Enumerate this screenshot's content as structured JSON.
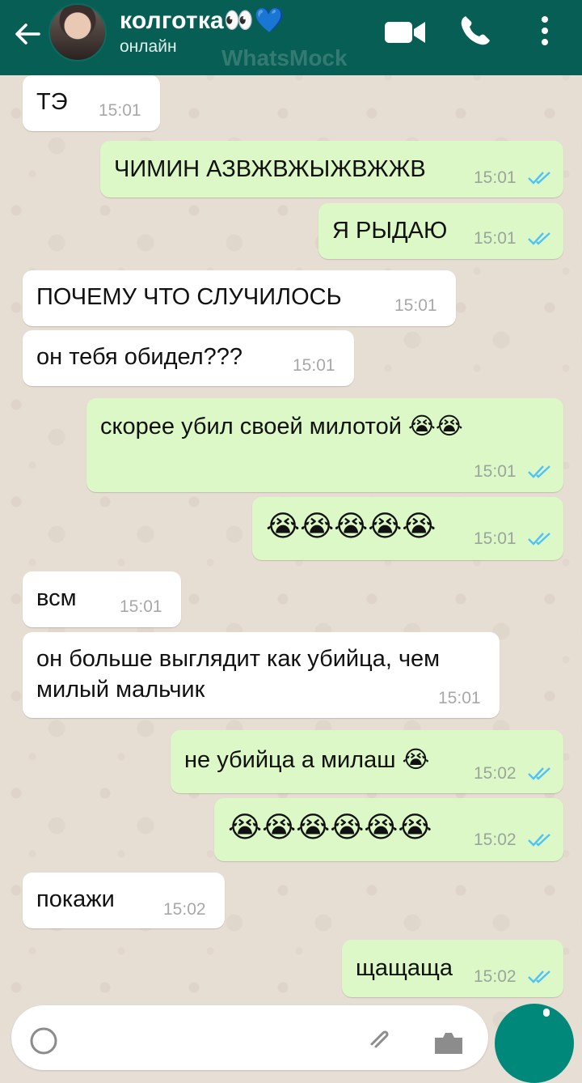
{
  "header": {
    "contact_name": "колготка👀💙",
    "status": "онлайн",
    "watermark": "WhatsMock"
  },
  "colors": {
    "header": "#075e54",
    "incoming_bubble": "#ffffff",
    "outgoing_bubble": "#dcf8c6",
    "read_ticks": "#4fc3f7",
    "mic_button": "#00897b"
  },
  "messages": [
    {
      "direction": "in",
      "text": "ТЭ",
      "time": "15:01"
    },
    {
      "direction": "out",
      "text": "ЧИМИН АЗВЖВЖЫЖВЖЖВ",
      "time": "15:01",
      "read": true
    },
    {
      "direction": "out",
      "text": "Я РЫДАЮ",
      "time": "15:01",
      "read": true
    },
    {
      "direction": "in",
      "text": "ПОЧЕМУ ЧТО СЛУЧИЛОСЬ",
      "time": "15:01"
    },
    {
      "direction": "in",
      "text": "он тебя обидел???",
      "time": "15:01"
    },
    {
      "direction": "out",
      "text": "скорее убил своей милотой 😭😭",
      "time": "15:01",
      "read": true
    },
    {
      "direction": "out",
      "text": "😭😭😭😭😭",
      "time": "15:01",
      "read": true
    },
    {
      "direction": "in",
      "text": "всм",
      "time": "15:01"
    },
    {
      "direction": "in",
      "text": "он больше выглядит как убийца, чем\nмилый мальчик",
      "time": "15:01"
    },
    {
      "direction": "out",
      "text": "не убийца а милаш 😭",
      "time": "15:02",
      "read": true
    },
    {
      "direction": "out",
      "text": "😭😭😭😭😭😭",
      "time": "15:02",
      "read": true
    },
    {
      "direction": "in",
      "text": "покажи",
      "time": "15:02"
    },
    {
      "direction": "out",
      "text": "щащаща",
      "time": "15:02",
      "read": true
    }
  ]
}
